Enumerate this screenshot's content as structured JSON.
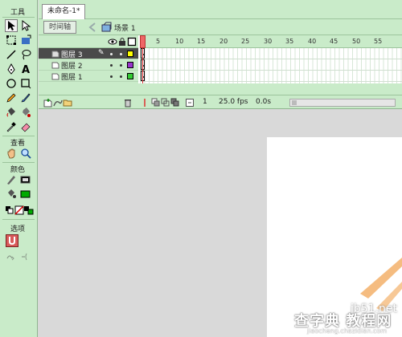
{
  "tools": {
    "title": "工具",
    "view_title": "查看",
    "color_title": "颜色",
    "options_title": "选项"
  },
  "document": {
    "tab_title": "未命名-1*"
  },
  "scene": {
    "timeline_button": "时间轴",
    "scene_name": "场景 1"
  },
  "timeline": {
    "frame_numbers": [
      "5",
      "10",
      "15",
      "20",
      "25",
      "30",
      "35",
      "40",
      "45",
      "50",
      "55"
    ],
    "layers": [
      {
        "name": "图层 3",
        "color": "#ffff00",
        "active": true
      },
      {
        "name": "图层 2",
        "color": "#9933cc",
        "active": false
      },
      {
        "name": "图层 1",
        "color": "#33cc33",
        "active": false
      }
    ],
    "current_frame": "1",
    "fps": "25.0 fps",
    "time": "0.0s"
  },
  "watermark": {
    "site": "jb51.net",
    "title": "查字典 教程网",
    "url": "jiaocheng.chazidian.com"
  }
}
